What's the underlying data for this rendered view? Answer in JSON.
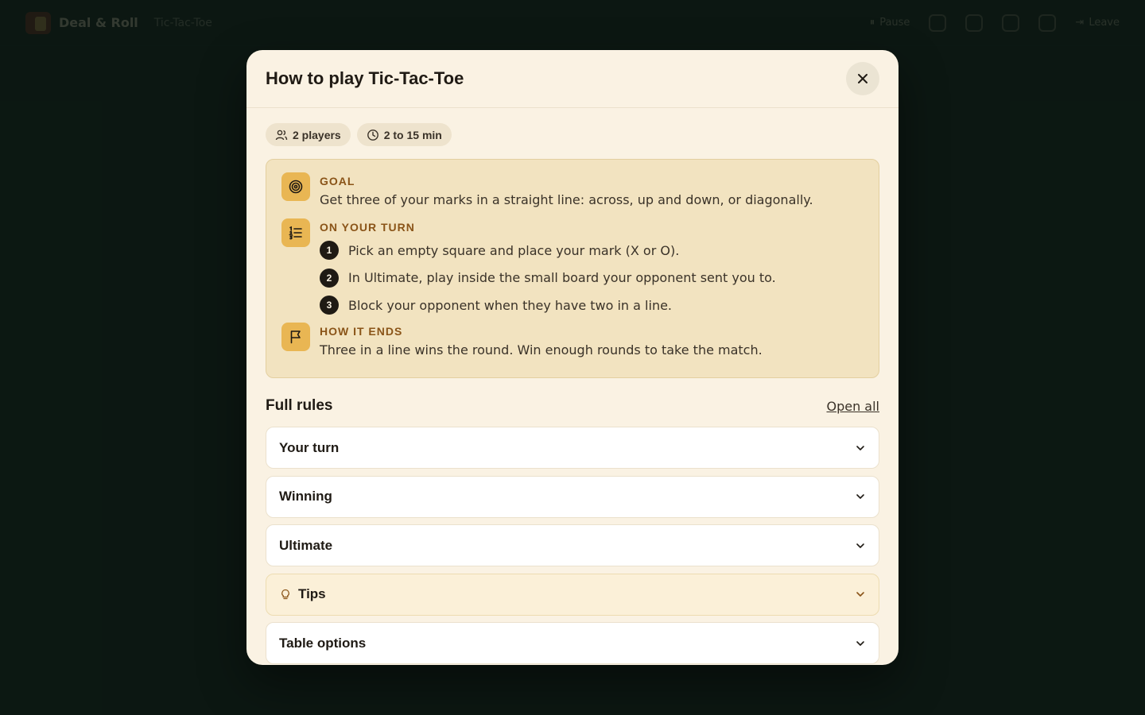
{
  "app": {
    "brand_name": "Deal & Roll",
    "game_name": "Tic-Tac-Toe",
    "top_pause_label": "Pause",
    "top_user_label": "Leave"
  },
  "modal": {
    "title": "How to play Tic-Tac-Toe",
    "chips": [
      {
        "icon": "players-icon",
        "label": "2 players"
      },
      {
        "icon": "clock-icon",
        "label": "2 to 15 min"
      }
    ],
    "summary": {
      "goal_label": "GOAL",
      "goal_text": "Get three of your marks in a straight line: across, up and down, or diagonally.",
      "turn_label": "ON YOUR TURN",
      "steps": [
        {
          "num": "1",
          "text": "Pick an empty square and place your mark (X or O)."
        },
        {
          "num": "2",
          "text": "In Ultimate, play inside the small board your opponent sent you to."
        },
        {
          "num": "3",
          "text": "Block your opponent when they have two in a line."
        }
      ],
      "ends_label": "HOW IT ENDS",
      "ends_text": "Three in a line wins the round. Win enough rounds to take the match."
    },
    "full_rules_title": "Full rules",
    "open_all_label": "Open all",
    "sections": [
      {
        "label": "Your turn"
      },
      {
        "label": "Winning"
      },
      {
        "label": "Ultimate"
      },
      {
        "label": "Tips",
        "icon": "lightbulb-icon"
      },
      {
        "label": "Table options"
      }
    ]
  },
  "colors": {
    "background": "#0f1d17",
    "modal": "#faf2e3",
    "summary_bg": "#f2e3c0",
    "accent_icon": "#e9b653",
    "label_brown": "#8a5418"
  }
}
